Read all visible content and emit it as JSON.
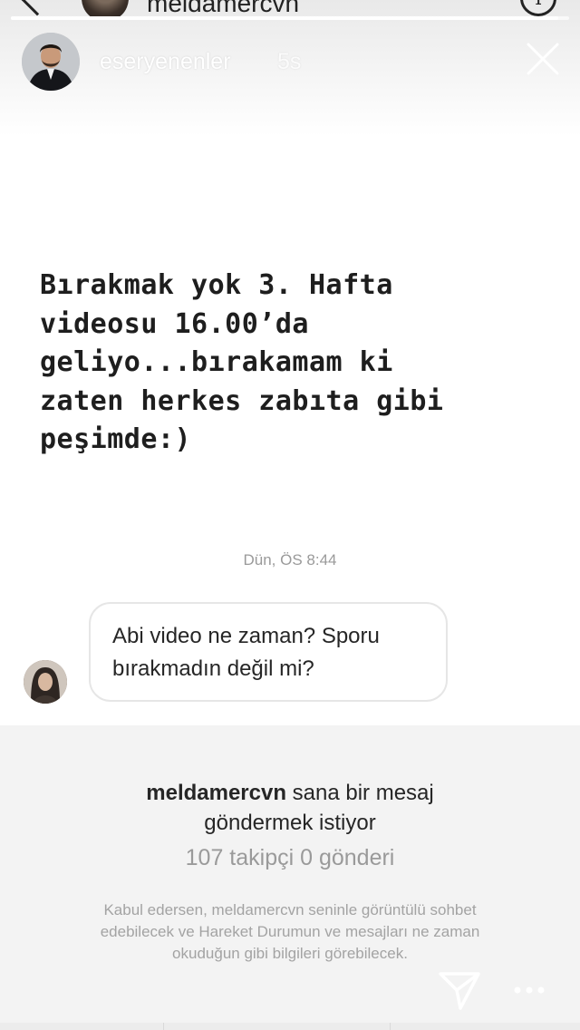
{
  "underlying_chat": {
    "username": "meldamercvn",
    "info_symbol": "i"
  },
  "story": {
    "progress": 0.98,
    "username": "eseryenenler",
    "time_ago": "5s",
    "text_lines": [
      "Bırakmak yok 3. Hafta",
      "videosu 16.00’da",
      "geliyo...bırakamam ki",
      "zaten herkes zabıta gibi",
      "peşimde:)"
    ]
  },
  "message": {
    "timestamp": "Dün, ÖS 8:44",
    "line1": "Abi video ne zaman? Sporu",
    "line2": "bırakmadın değil mi?"
  },
  "request": {
    "username": "meldamercvn",
    "title_line1_rest": " sana bir mesaj",
    "title_line2": "göndermek istiyor",
    "stats": "107 takipçi 0 gönderi",
    "note_line1": "Kabul edersen, meldamercvn seninle görüntülü sohbet",
    "note_line2": "edebilecek ve Hareket Durumun ve mesajları ne zaman",
    "note_line3": "okuduğun gibi bilgileri görebilecek."
  },
  "colors": {
    "text_primary": "#262626",
    "text_secondary": "#9a9a9a",
    "story_overlay_text": "#ffffff"
  },
  "icons": [
    "back-chevron-icon",
    "info-icon",
    "close-icon",
    "send-icon",
    "more-icon"
  ]
}
